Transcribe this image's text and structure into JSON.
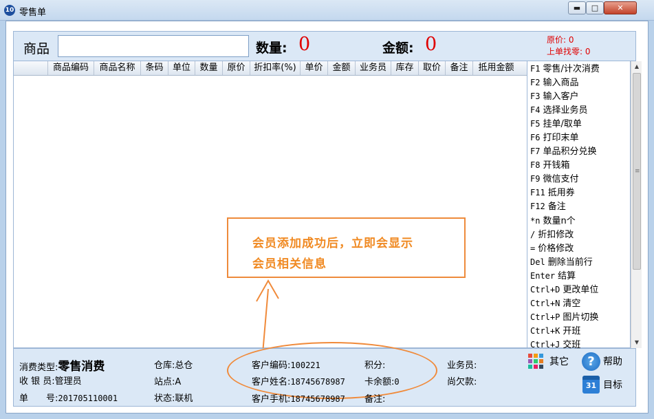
{
  "window": {
    "title": "零售单",
    "app_icon_text": "10",
    "buttons": {
      "minimize": "▬",
      "maximize": "□",
      "close": "✕"
    }
  },
  "top": {
    "goods_label": "商品",
    "goods_value": "",
    "qty_label": "数量:",
    "qty_value": "0",
    "amount_label": "金额:",
    "amount_value": "0",
    "original_price": "原价: 0",
    "last_change": "上单找零: 0"
  },
  "grid": {
    "columns": [
      "",
      "商品编码",
      "商品名称",
      "条码",
      "单位",
      "数量",
      "原价",
      "折扣率(%)",
      "单价",
      "金额",
      "业务员",
      "库存",
      "取价",
      "备注",
      "抵用金额"
    ],
    "rows": []
  },
  "shortcuts": [
    {
      "key": "F1",
      "label": "零售/计次消费"
    },
    {
      "key": "F2",
      "label": "输入商品"
    },
    {
      "key": "F3",
      "label": "输入客户"
    },
    {
      "key": "F4",
      "label": "选择业务员"
    },
    {
      "key": "F5",
      "label": "挂单/取单"
    },
    {
      "key": "F6",
      "label": "打印末单"
    },
    {
      "key": "F7",
      "label": "单品积分兑换"
    },
    {
      "key": "F8",
      "label": "开钱箱"
    },
    {
      "key": "F9",
      "label": "微信支付"
    },
    {
      "key": "F11",
      "label": "抵用券"
    },
    {
      "key": "F12",
      "label": "备注"
    },
    {
      "key": "*n",
      "label": "数量n个"
    },
    {
      "key": "/",
      "label": "折扣修改"
    },
    {
      "key": "=",
      "label": "价格修改"
    },
    {
      "key": "Del",
      "label": "删除当前行"
    },
    {
      "key": "Enter",
      "label": "结算"
    },
    {
      "key": "Ctrl+D",
      "label": "更改单位"
    },
    {
      "key": "Ctrl+N",
      "label": "清空"
    },
    {
      "key": "Ctrl+P",
      "label": "图片切换"
    },
    {
      "key": "Ctrl+K",
      "label": "开班"
    },
    {
      "key": "Ctrl+J",
      "label": "交班"
    }
  ],
  "callout": {
    "line1": "会员添加成功后，立即会显示",
    "line2": "会员相关信息",
    "color": "#f08a23"
  },
  "bottom": {
    "consume_type_label": "消费类型:",
    "consume_type_value": "零售消费",
    "cashier_label": "收 银 员:",
    "cashier_value": "管理员",
    "order_no_label": "单　　号:",
    "order_no_value": "201705110001",
    "warehouse_label": "仓库:",
    "warehouse_value": "总仓",
    "site_label": "站点:",
    "site_value": "A",
    "status_label": "状态:",
    "status_value": "联机",
    "customer_code_label": "客户编码:",
    "customer_code_value": "100221",
    "customer_name_label": "客户姓名:",
    "customer_name_value": "18745678987",
    "customer_phone_label": "客户手机:",
    "customer_phone_value": "18745678987",
    "points_label": "积分:",
    "points_value": "",
    "card_balance_label": "卡余额:",
    "card_balance_value": "0",
    "remark_label": "备注:",
    "remark_value": "",
    "salesman_label": "业务员:",
    "salesman_value": "",
    "owed_label": "尚欠款:",
    "owed_value": "",
    "other_button": "其它",
    "help_button": "帮助",
    "goal_button": "目标",
    "help_icon_text": "?",
    "goal_icon_text": "31"
  },
  "colors": {
    "accent_red": "#e00000",
    "panel_bg": "#dbe8f6",
    "callout_border": "#ee8a3a"
  }
}
